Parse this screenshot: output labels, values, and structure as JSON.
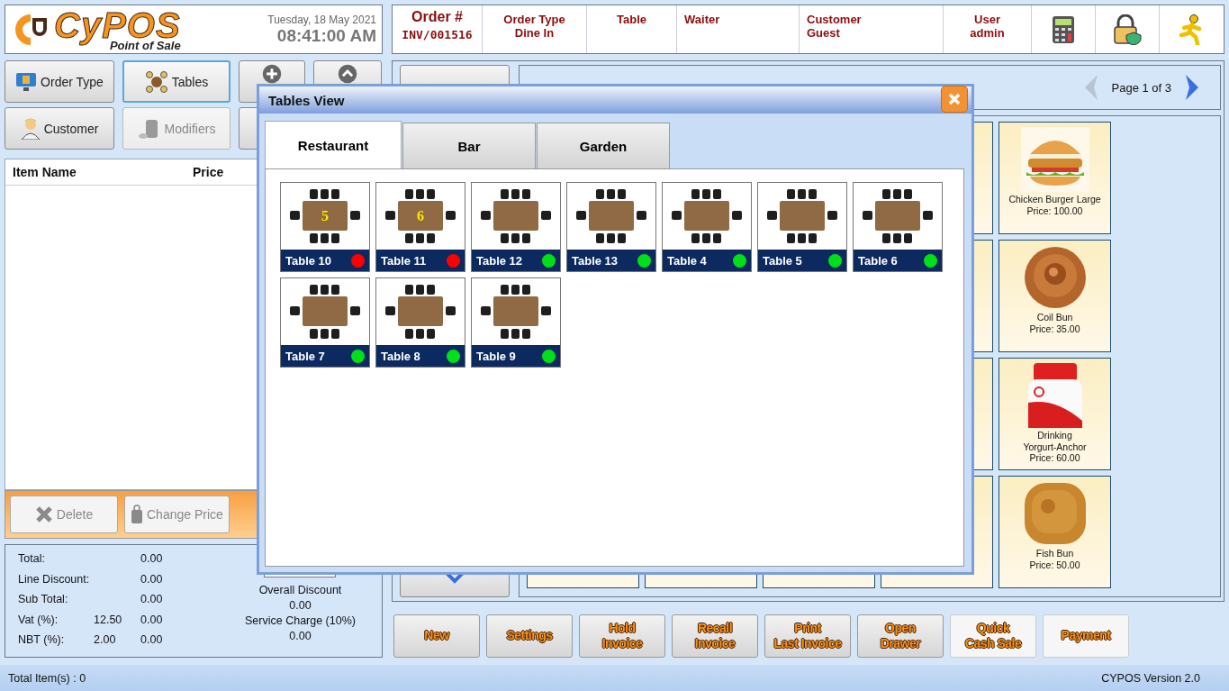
{
  "logo": {
    "name": "CyPOS",
    "tagline": "Point of Sale"
  },
  "datetime": {
    "date": "Tuesday, 18 May 2021",
    "time": "08:41:00 AM"
  },
  "order_info": [
    {
      "label": "Order #",
      "value": "INV/001516"
    },
    {
      "label": "Order Type",
      "value": "Dine In"
    },
    {
      "label": "Table"
    },
    {
      "label": "Waiter"
    },
    {
      "label": "Customer",
      "value": "Guest"
    },
    {
      "label": "User",
      "value": "admin"
    }
  ],
  "header_tools": [
    {
      "kind": "calculator"
    },
    {
      "kind": "lock"
    },
    {
      "kind": "runner"
    }
  ],
  "left_buttons": [
    {
      "kind": "order-type",
      "label": "Order Type",
      "selected": false,
      "disabled": false
    },
    {
      "kind": "tables",
      "label": "Tables",
      "selected": true,
      "disabled": false
    },
    {
      "kind": "plus"
    },
    {
      "kind": "up"
    },
    {
      "kind": "customer",
      "label": "Customer",
      "selected": false,
      "disabled": false
    },
    {
      "kind": "modifiers",
      "label": "Modifiers",
      "selected": false,
      "disabled": true
    }
  ],
  "item_table": {
    "columns": [
      "Item Name",
      "Price"
    ]
  },
  "item_actions": [
    {
      "kind": "delete",
      "label": "Delete",
      "disabled": true
    },
    {
      "kind": "change-price",
      "label": "Change Price",
      "disabled": true
    }
  ],
  "totals": [
    {
      "label": "Total:",
      "value": "0.00"
    },
    {
      "label": "Line Discount:",
      "value": "0.00"
    },
    {
      "label": "Sub Total:",
      "value": "0.00"
    },
    {
      "label": "Vat (%):",
      "rate": "12.50",
      "value": "0.00"
    },
    {
      "label": "NBT (%):",
      "rate": "2.00",
      "value": "0.00"
    }
  ],
  "charges": {
    "overall_discount_label": "Overall Discount",
    "overall_discount": "0.00",
    "service_charge_label": "Service Charge (10%)",
    "service_charge": "0.00"
  },
  "pager": {
    "text": "Page  1  of  3",
    "prev_disabled": true,
    "next_disabled": false
  },
  "products": [
    {
      "name": "Chicken Burger Large",
      "price": "Price: 100.00",
      "kind": "burger"
    },
    {
      "name": "Coil Bun",
      "price": "Price: 35.00",
      "kind": "bun"
    },
    {
      "name": "Drinking\nYorgurt-Anchor",
      "price": "Price: 60.00",
      "kind": "bottle"
    },
    {
      "name": "Fish Bun",
      "price": "Price: 50.00",
      "kind": "square-bun"
    }
  ],
  "action_buttons": [
    {
      "label": "New",
      "light": false
    },
    {
      "label": "Settings",
      "light": false
    },
    {
      "label": "Hold\nInvoice",
      "light": false
    },
    {
      "label": "Recall\nInvoice",
      "light": false
    },
    {
      "label": "Print\nLast Invoice",
      "light": false
    },
    {
      "label": "Open\nDrawer",
      "light": false
    },
    {
      "label": "Quick\nCash Sale",
      "light": true
    },
    {
      "label": "Payment",
      "light": true
    }
  ],
  "status_bar": {
    "left": "Total Item(s) : 0",
    "right": "CYPOS Version 2.0"
  },
  "dialog": {
    "title": "Tables View",
    "tabs": [
      {
        "label": "Restaurant",
        "selected": true
      },
      {
        "label": "Bar",
        "selected": false
      },
      {
        "label": "Garden",
        "selected": false
      }
    ],
    "tables": [
      {
        "name": "Table 10",
        "number": "5",
        "color": "#ff0000"
      },
      {
        "name": "Table 11",
        "number": "6",
        "color": "#ff0000"
      },
      {
        "name": "Table 12",
        "color": "#00e01a"
      },
      {
        "name": "Table 13",
        "color": "#00e01a"
      },
      {
        "name": "Table 4",
        "color": "#00e01a"
      },
      {
        "name": "Table 5",
        "color": "#00e01a"
      },
      {
        "name": "Table 6",
        "color": "#00e01a"
      },
      {
        "name": "Table 7",
        "color": "#00e01a"
      },
      {
        "name": "Table 8",
        "color": "#00e01a"
      },
      {
        "name": "Table 9",
        "color": "#00e01a"
      }
    ]
  }
}
